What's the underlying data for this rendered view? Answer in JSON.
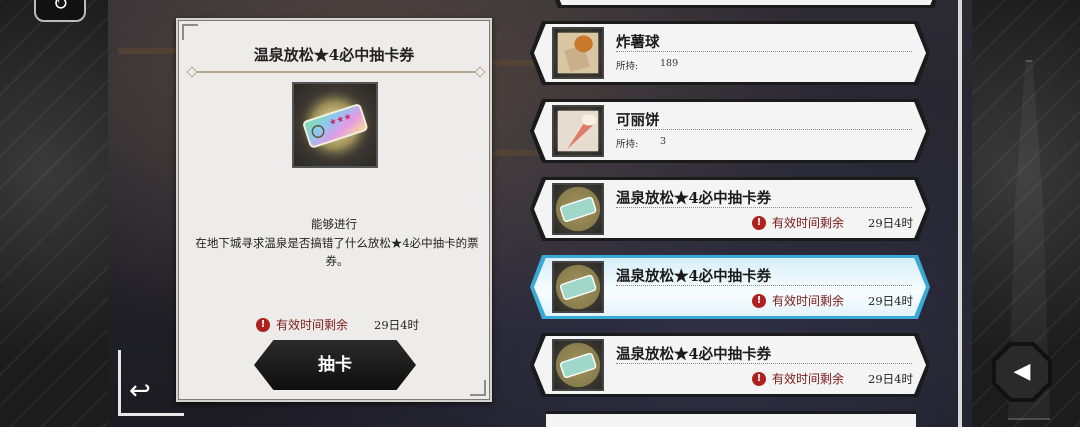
{
  "detail": {
    "title": "温泉放松★4必中抽卡券",
    "desc_line1": "能够进行",
    "desc_line2": "在地下城寻求温泉是否搞错了什么放松★4必中抽卡的票券。",
    "expiry_label": "有效时间剩余",
    "expiry_value": "29日4时",
    "draw_button_label": "抽卡"
  },
  "items": [
    {
      "name": "炸薯球",
      "held_label": "所持:",
      "held_value": "189",
      "icon": "fries-icon"
    },
    {
      "name": "可丽饼",
      "held_label": "所持:",
      "held_value": "3",
      "icon": "crepe-icon"
    },
    {
      "name": "温泉放松★4必中抽卡券",
      "expiry_label": "有效时间剩余",
      "expiry_value": "29日4时",
      "icon": "ticket-icon"
    },
    {
      "name": "温泉放松★4必中抽卡券",
      "expiry_label": "有效时间剩余",
      "expiry_value": "29日4时",
      "icon": "ticket-icon",
      "selected": true
    },
    {
      "name": "温泉放松★4必中抽卡券",
      "expiry_label": "有效时间剩余",
      "expiry_value": "29日4时",
      "icon": "ticket-icon"
    }
  ],
  "icons": {
    "warning": "!",
    "back": "↻",
    "return": "↩",
    "sound": "◀"
  },
  "colors": {
    "panel_bg": "#eeeceb",
    "selected_item": "#d9eff7",
    "warning": "#b0201e",
    "button": "#111111"
  }
}
